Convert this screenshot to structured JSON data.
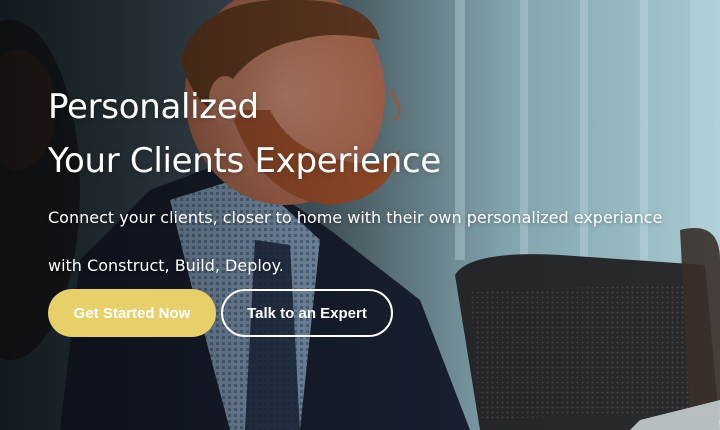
{
  "hero": {
    "headline_line1": "Personalized",
    "headline_line2": "Your Clients Experience",
    "subtext_line1": "Connect your clients, closer to home with their own personalized experiance",
    "subtext_line2": "with Construct, Build, Deploy.",
    "primary_cta_label": "Get Started Now",
    "secondary_cta_label": "Talk to an Expert"
  },
  "colors": {
    "primary_cta_bg": "#e7cf6a",
    "text": "#ffffff"
  }
}
